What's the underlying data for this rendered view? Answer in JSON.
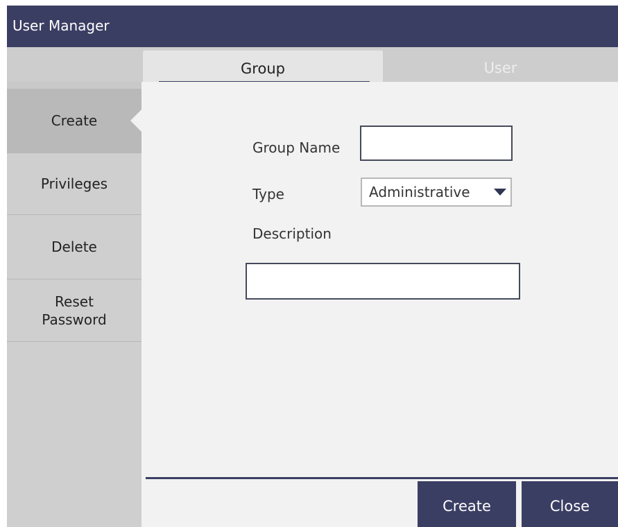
{
  "window": {
    "title": "User Manager"
  },
  "tabs": [
    {
      "label": "Group",
      "active": true
    },
    {
      "label": "User",
      "active": false
    }
  ],
  "sidebar": {
    "items": [
      {
        "label": "Create",
        "active": true
      },
      {
        "label": "Privileges",
        "active": false
      },
      {
        "label": "Delete",
        "active": false
      },
      {
        "label": "Reset\nPassword",
        "active": false
      }
    ]
  },
  "form": {
    "group_name_label": "Group Name",
    "group_name_value": "",
    "type_label": "Type",
    "type_value": "Administrative",
    "description_label": "Description",
    "description_value": ""
  },
  "footer": {
    "create_label": "Create",
    "close_label": "Close"
  },
  "colors": {
    "accent": "#3b3e63",
    "sidebar_bg": "#cfcfcf",
    "sidebar_active": "#b9b9b9",
    "content_bg": "#f2f2f2"
  }
}
